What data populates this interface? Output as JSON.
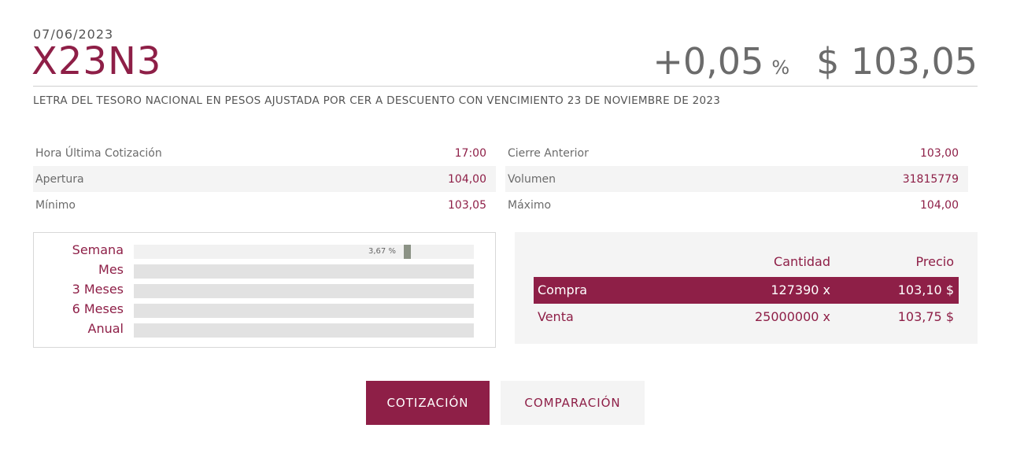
{
  "header": {
    "date": "07/06/2023",
    "ticker": "X23N3",
    "change": "+0,05",
    "change_unit": "%",
    "price": "$ 103,05",
    "description": "LETRA DEL TESORO NACIONAL EN PESOS AJUSTADA POR CER A DESCUENTO CON VENCIMIENTO 23 DE NOVIEMBRE DE 2023"
  },
  "stats_left": [
    {
      "label": "Hora Última Cotización",
      "value": "17:00"
    },
    {
      "label": "Apertura",
      "value": "104,00"
    },
    {
      "label": "Mínimo",
      "value": "103,05"
    }
  ],
  "stats_right": [
    {
      "label": "Cierre Anterior",
      "value": "103,00"
    },
    {
      "label": "Volumen",
      "value": "31815779"
    },
    {
      "label": "Máximo",
      "value": "104,00"
    }
  ],
  "performance": {
    "rows": [
      {
        "label": "Semana",
        "value_label": "3,67 %",
        "value_pct": 3.67
      },
      {
        "label": "Mes",
        "value_label": ""
      },
      {
        "label": "3 Meses",
        "value_label": ""
      },
      {
        "label": "6 Meses",
        "value_label": ""
      },
      {
        "label": "Anual",
        "value_label": ""
      }
    ]
  },
  "order_book": {
    "headers": {
      "quantity": "Cantidad",
      "price": "Precio"
    },
    "buy": {
      "label": "Compra",
      "quantity": "127390 x",
      "price": "103,10 $"
    },
    "sell": {
      "label": "Venta",
      "quantity": "25000000 x",
      "price": "103,75 $"
    }
  },
  "tabs": {
    "quote": "COTIZACIÓN",
    "compare": "COMPARACIÓN"
  },
  "colors": {
    "accent": "#8e1f47",
    "bar_marker": "#8b9285",
    "panel_bg": "#f4f4f4"
  }
}
